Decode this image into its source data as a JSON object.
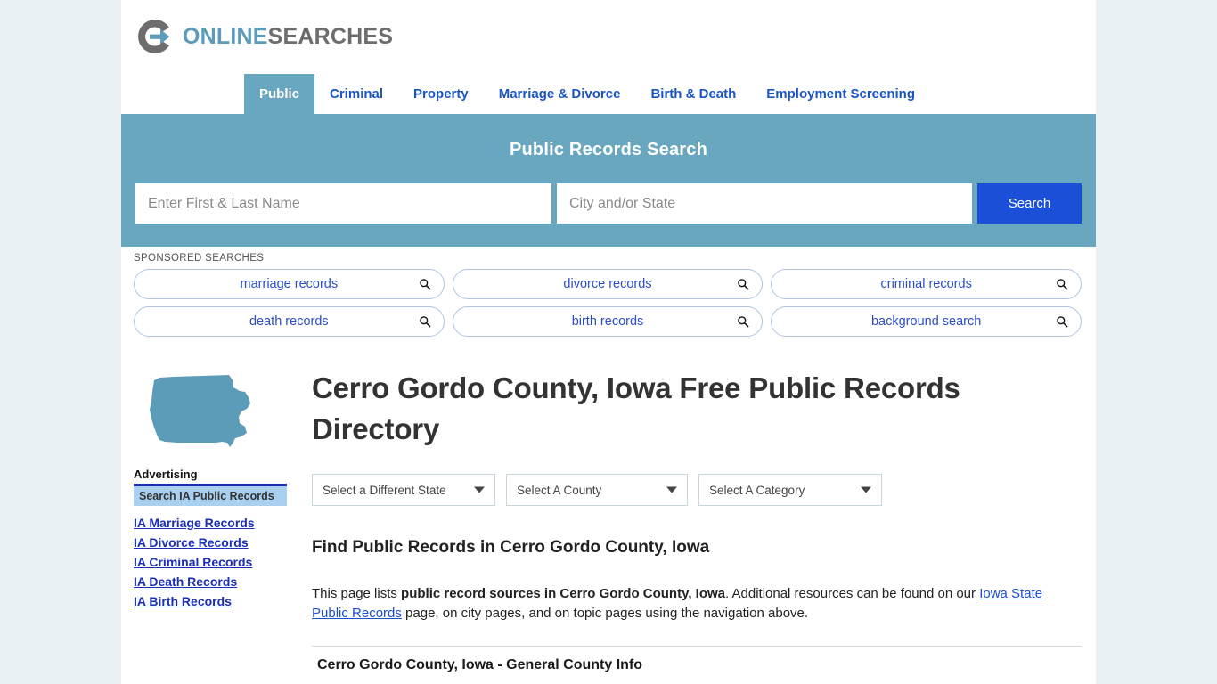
{
  "brand": {
    "name_part1": "ONLINE",
    "name_part2": "SEARCHES",
    "logo_icon": "circle-arrow-logo-icon",
    "accent_teal": "#69a7c1",
    "accent_gray": "#6d6d6d",
    "link_blue": "#1b55c4",
    "button_blue": "#1b4fd8"
  },
  "nav": {
    "tabs": [
      {
        "label": "Public",
        "active": true
      },
      {
        "label": "Criminal",
        "active": false
      },
      {
        "label": "Property",
        "active": false
      },
      {
        "label": "Marriage & Divorce",
        "active": false
      },
      {
        "label": "Birth & Death",
        "active": false
      },
      {
        "label": "Employment Screening",
        "active": false
      }
    ]
  },
  "search": {
    "title": "Public Records Search",
    "name_value": "",
    "name_placeholder": "Enter First & Last Name",
    "location_value": "",
    "location_placeholder": "City and/or State",
    "button_label": "Search"
  },
  "sponsored": {
    "label": "SPONSORED SEARCHES",
    "items": [
      {
        "label": "marriage records",
        "icon": "search-icon"
      },
      {
        "label": "divorce records",
        "icon": "search-icon"
      },
      {
        "label": "criminal records",
        "icon": "search-icon"
      },
      {
        "label": "death records",
        "icon": "search-icon"
      },
      {
        "label": "birth records",
        "icon": "search-icon"
      },
      {
        "label": "background search",
        "icon": "search-icon"
      }
    ]
  },
  "main": {
    "state_map_icon": "iowa-state-map-icon",
    "page_title": "Cerro Gordo County, Iowa Free Public Records Directory",
    "selects": {
      "state": "Select a Different State",
      "county": "Select A County",
      "category": "Select A Category"
    },
    "section_heading": "Find Public Records in Cerro Gordo County, Iowa",
    "paragraph": {
      "part1": "This page lists ",
      "bold1": "public record sources in Cerro Gordo County, Iowa",
      "part2": ". Additional resources can be found on our ",
      "link1": "Iowa State Public Records",
      "part3": " page, on city pages, and on topic pages using the navigation above."
    },
    "table_heading": "Cerro Gordo County, Iowa - General County Info"
  },
  "sidebar": {
    "ad_title": "Advertising",
    "ad_header": "Search IA Public Records",
    "links": [
      "IA Marriage Records",
      "IA Divorce Records",
      "IA Criminal Records",
      "IA Death Records",
      "IA Birth Records"
    ]
  }
}
